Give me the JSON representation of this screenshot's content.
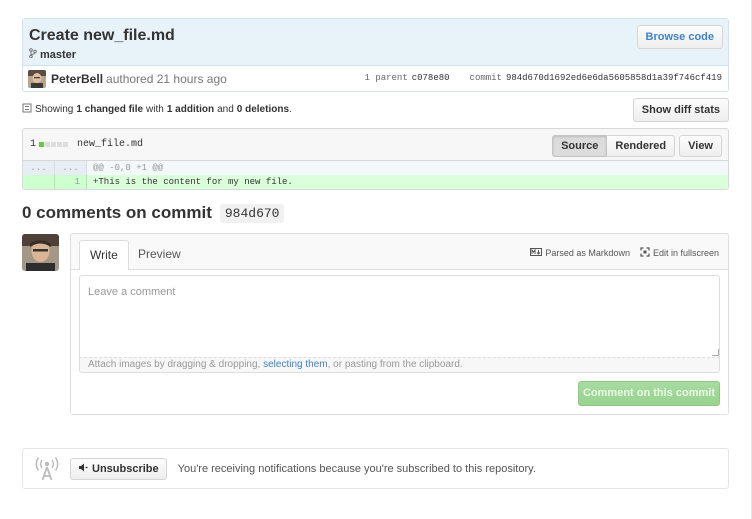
{
  "commit": {
    "title": "Create new_file.md",
    "branch": "master",
    "browse_label": "Browse code",
    "author": "PeterBell",
    "authored_text": "authored 21 hours ago",
    "parent_label": "1 parent",
    "parent_sha": "c078e80",
    "commit_label": "commit",
    "commit_sha": "984d670d1692ed6e6da5605858d1a39f746cf419"
  },
  "toc": {
    "showing": "Showing",
    "changed": "1 changed file",
    "with": "with",
    "additions": "1 addition",
    "and": "and",
    "deletions": "0 deletions",
    "period": ".",
    "diff_stats_label": "Show diff stats"
  },
  "file": {
    "count": "1",
    "name": "new_file.md",
    "source_label": "Source",
    "rendered_label": "Rendered",
    "view_label": "View",
    "hunk_ln_old": "...",
    "hunk_ln_new": "...",
    "hunk_text": "@@ -0,0 +1 @@",
    "add_ln_new": "1",
    "add_text": "+This is the content for my new file."
  },
  "comments": {
    "heading": "0 comments on commit",
    "sha": "984d670"
  },
  "form": {
    "write_tab": "Write",
    "preview_tab": "Preview",
    "markdown_label": "Parsed as Markdown",
    "fullscreen_label": "Edit in fullscreen",
    "placeholder": "Leave a comment",
    "attach_pre": "Attach images by dragging & dropping, ",
    "attach_link": "selecting them",
    "attach_post": ", or pasting from the clipboard.",
    "submit_label": "Comment on this commit"
  },
  "notifications": {
    "unsubscribe_label": "Unsubscribe",
    "text": "You're receiving notifications because you're subscribed to this repository."
  },
  "colors": {
    "link": "#4183c4",
    "header_bg": "#e8f3f9",
    "add_bg": "#dbffdb",
    "submit": "#97d38e"
  }
}
